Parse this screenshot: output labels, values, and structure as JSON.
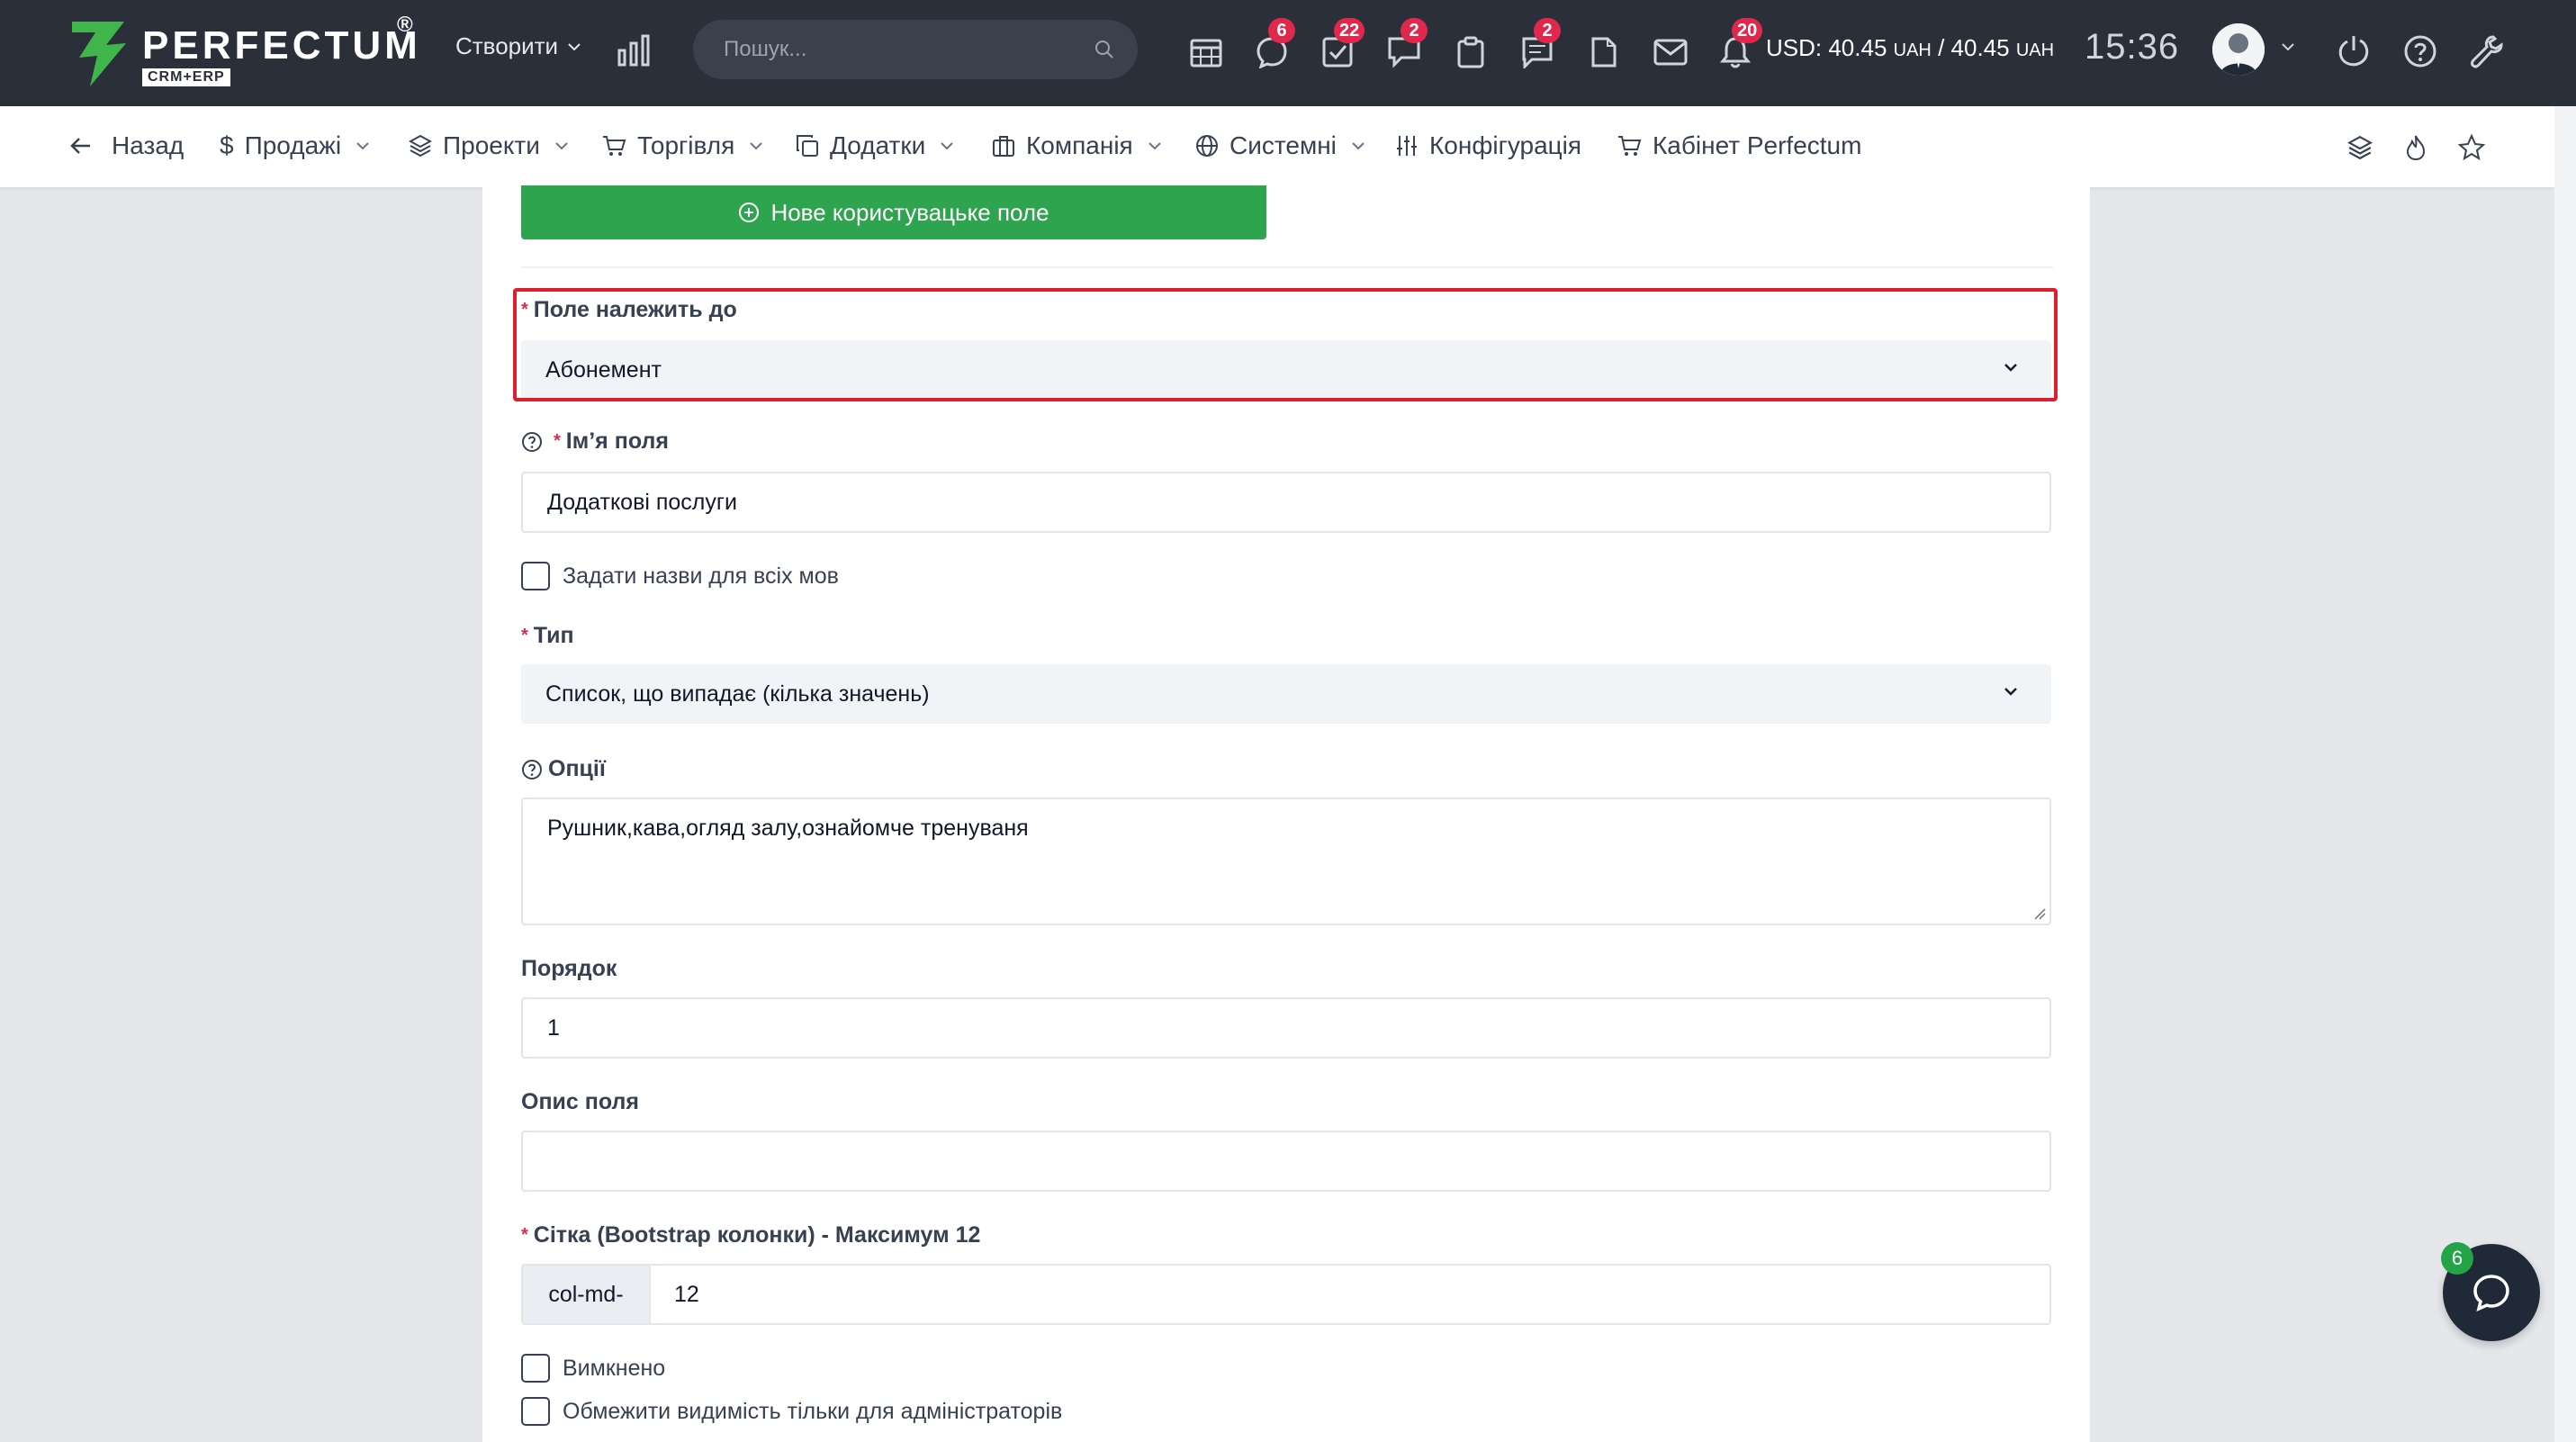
{
  "topbar": {
    "logo_text": "PERFECTUM",
    "logo_reg": "®",
    "logo_sub": "CRM+ERP",
    "create_label": "Створити",
    "search_placeholder": "Пошук...",
    "icons": [
      {
        "name": "calendar-icon",
        "badge": ""
      },
      {
        "name": "chat-bubble-icon",
        "badge": "6"
      },
      {
        "name": "tasks-icon",
        "badge": "22"
      },
      {
        "name": "comments-icon",
        "badge": "2"
      },
      {
        "name": "clipboard-icon",
        "badge": ""
      },
      {
        "name": "messages-icon",
        "badge": "2"
      },
      {
        "name": "document-icon",
        "badge": ""
      },
      {
        "name": "mail-icon",
        "badge": ""
      },
      {
        "name": "notifications-icon",
        "badge": "20"
      }
    ],
    "currency_main": "USD: 40.45 ",
    "currency_unit1": "UAH",
    "currency_mid": " / 40.45 ",
    "currency_unit2": "UAH",
    "clock": "15:36"
  },
  "navbar": {
    "back": "Назад",
    "items": [
      {
        "label": "Продажі"
      },
      {
        "label": "Проекти"
      },
      {
        "label": "Торгівля"
      },
      {
        "label": "Додатки"
      },
      {
        "label": "Компанія"
      },
      {
        "label": "Системні"
      },
      {
        "label": "Конфігурація"
      },
      {
        "label": "Кабінет Perfectum"
      }
    ]
  },
  "form": {
    "new_field_button": "Нове користувацьке поле",
    "required_mark": "*",
    "belongs_to_label": "Поле належить до",
    "belongs_to_value": "Абонемент",
    "field_name_label": "Ім’я поля",
    "field_name_value": "Додаткові послуги",
    "all_languages_label": "Задати назви для всіх мов",
    "type_label": "Тип",
    "type_value": "Список, що випадає (кілька значень)",
    "options_label": "Опції",
    "options_value": "Рушник,кава,огляд залу,ознайомче тренуваня",
    "order_label": "Порядок",
    "order_value": "1",
    "description_label": "Опис поля",
    "description_value": "",
    "grid_label": "Сітка (Bootstrap колонки) - Максимум 12",
    "grid_prefix": "col-md-",
    "grid_value": "12",
    "disabled_label": "Вимкнено",
    "admin_only_label": "Обмежити видимість тільки для адміністраторів"
  },
  "chat_widget": {
    "badge": "6"
  },
  "colors": {
    "topbar_bg": "#2b2f3a",
    "accent_green": "#2ea44f",
    "badge_red": "#e0284d",
    "highlight_red": "#dc1e2f"
  }
}
